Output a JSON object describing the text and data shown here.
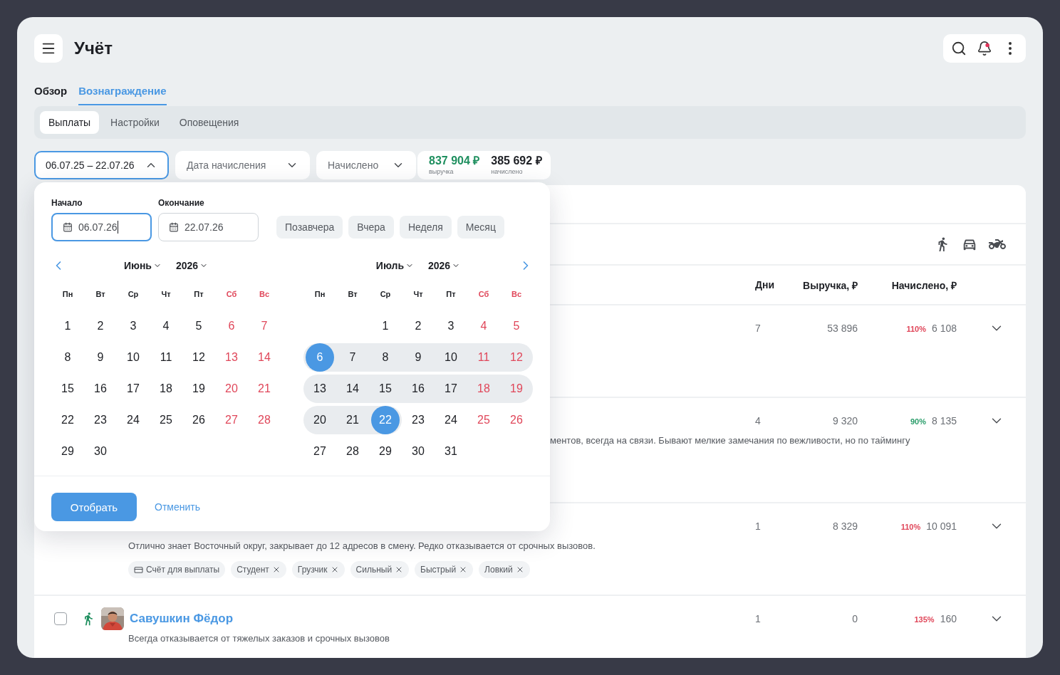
{
  "app": {
    "title": "Учёт"
  },
  "tabs": [
    {
      "label": "Обзор",
      "selected": false
    },
    {
      "label": "Вознаграждение",
      "selected": true
    }
  ],
  "subtabs": [
    {
      "label": "Выплаты",
      "selected": true
    },
    {
      "label": "Настройки",
      "selected": false
    },
    {
      "label": "Оповещения",
      "selected": false
    }
  ],
  "filters": [
    {
      "kind": "range",
      "value": "06.07.25 – 22.07.26",
      "expanded": true
    },
    {
      "kind": "select",
      "value": "Дата начисления",
      "expanded": false
    },
    {
      "kind": "select",
      "value": "Начислено",
      "expanded": false
    }
  ],
  "totals": [
    {
      "value": "837 904 ₽",
      "caption": "выручка",
      "color": "#1f8f5f"
    },
    {
      "value": "385 692 ₽",
      "caption": "начислено",
      "color": "#1d1f24"
    }
  ],
  "date_picker": {
    "fields": [
      {
        "label": "Начало",
        "value": "06.07.26",
        "focused": true
      },
      {
        "label": "Окончание",
        "value": "22.07.26",
        "focused": false
      }
    ],
    "presets": [
      "Позавчера",
      "Вчера",
      "Неделя",
      "Месяц"
    ],
    "months": [
      {
        "month": "Июнь",
        "year": "2026",
        "weekdays": [
          {
            "label": "Пн",
            "weekend": false
          },
          {
            "label": "Вт",
            "weekend": false
          },
          {
            "label": "Ср",
            "weekend": false
          },
          {
            "label": "Чт",
            "weekend": false
          },
          {
            "label": "Пт",
            "weekend": false
          },
          {
            "label": "Сб",
            "weekend": true
          },
          {
            "label": "Вс",
            "weekend": true
          }
        ],
        "weeks": [
          {
            "kind": "leading",
            "days": [
              {
                "label": "1",
                "selected": false,
                "in_range": false
              },
              {
                "label": "2",
                "selected": false,
                "in_range": false
              },
              {
                "label": "3",
                "selected": false,
                "in_range": false
              },
              {
                "label": "4",
                "selected": false,
                "in_range": false
              },
              {
                "label": "5",
                "selected": false,
                "in_range": false
              },
              {
                "label": "6",
                "selected": false,
                "in_range": false
              },
              {
                "label": "7",
                "selected": false,
                "in_range": false
              }
            ]
          },
          {
            "kind": "leading",
            "days": [
              {
                "label": "8",
                "selected": false,
                "in_range": false
              },
              {
                "label": "9",
                "selected": false,
                "in_range": false
              },
              {
                "label": "10",
                "selected": false,
                "in_range": false
              },
              {
                "label": "11",
                "selected": false,
                "in_range": false
              },
              {
                "label": "12",
                "selected": false,
                "in_range": false
              },
              {
                "label": "13",
                "selected": false,
                "in_range": false
              },
              {
                "label": "14",
                "selected": false,
                "in_range": false
              }
            ]
          },
          {
            "kind": "leading",
            "days": [
              {
                "label": "15",
                "selected": false,
                "in_range": false
              },
              {
                "label": "16",
                "selected": false,
                "in_range": false
              },
              {
                "label": "17",
                "selected": false,
                "in_range": false
              },
              {
                "label": "18",
                "selected": false,
                "in_range": false
              },
              {
                "label": "19",
                "selected": false,
                "in_range": false
              },
              {
                "label": "20",
                "selected": false,
                "in_range": false
              },
              {
                "label": "21",
                "selected": false,
                "in_range": false
              }
            ]
          },
          {
            "kind": "leading",
            "days": [
              {
                "label": "22",
                "selected": false,
                "in_range": false
              },
              {
                "label": "23",
                "selected": false,
                "in_range": false
              },
              {
                "label": "24",
                "selected": false,
                "in_range": false
              },
              {
                "label": "25",
                "selected": false,
                "in_range": false
              },
              {
                "label": "26",
                "selected": false,
                "in_range": false
              },
              {
                "label": "27",
                "selected": false,
                "in_range": false
              },
              {
                "label": "28",
                "selected": false,
                "in_range": false
              }
            ]
          },
          {
            "kind": "leading",
            "days": [
              {
                "label": "29",
                "selected": false,
                "in_range": false
              },
              {
                "label": "30",
                "selected": false,
                "in_range": false
              }
            ]
          }
        ]
      },
      {
        "month": "Июль",
        "year": "2026",
        "weekdays": [
          {
            "label": "Пн",
            "weekend": false
          },
          {
            "label": "Вт",
            "weekend": false
          },
          {
            "label": "Ср",
            "weekend": false
          },
          {
            "label": "Чт",
            "weekend": false
          },
          {
            "label": "Пт",
            "weekend": false
          },
          {
            "label": "Сб",
            "weekend": true
          },
          {
            "label": "Вс",
            "weekend": true
          }
        ],
        "weeks": [
          {
            "kind": "trailing",
            "days": [
              {
                "label": "1",
                "selected": false,
                "in_range": false
              },
              {
                "label": "2",
                "selected": false,
                "in_range": false
              },
              {
                "label": "3",
                "selected": false,
                "in_range": false
              },
              {
                "label": "4",
                "selected": false,
                "in_range": false
              },
              {
                "label": "5",
                "selected": false,
                "in_range": false
              }
            ]
          },
          {
            "kind": "leading",
            "days": [
              {
                "label": "6",
                "selected": true,
                "in_range": true
              },
              {
                "label": "7",
                "selected": false,
                "in_range": true
              },
              {
                "label": "8",
                "selected": false,
                "in_range": true
              },
              {
                "label": "9",
                "selected": false,
                "in_range": true
              },
              {
                "label": "10",
                "selected": false,
                "in_range": true
              },
              {
                "label": "11",
                "selected": false,
                "in_range": true
              },
              {
                "label": "12",
                "selected": false,
                "in_range": true
              }
            ]
          },
          {
            "kind": "leading",
            "days": [
              {
                "label": "13",
                "selected": false,
                "in_range": true
              },
              {
                "label": "14",
                "selected": false,
                "in_range": true
              },
              {
                "label": "15",
                "selected": false,
                "in_range": true
              },
              {
                "label": "16",
                "selected": false,
                "in_range": true
              },
              {
                "label": "17",
                "selected": false,
                "in_range": true
              },
              {
                "label": "18",
                "selected": false,
                "in_range": true
              },
              {
                "label": "19",
                "selected": false,
                "in_range": true
              }
            ]
          },
          {
            "kind": "leading",
            "days": [
              {
                "label": "20",
                "selected": false,
                "in_range": true
              },
              {
                "label": "21",
                "selected": false,
                "in_range": true
              },
              {
                "label": "22",
                "selected": true,
                "in_range": true
              },
              {
                "label": "23",
                "selected": false,
                "in_range": false
              },
              {
                "label": "24",
                "selected": false,
                "in_range": false
              },
              {
                "label": "25",
                "selected": false,
                "in_range": false
              },
              {
                "label": "26",
                "selected": false,
                "in_range": false
              }
            ]
          },
          {
            "kind": "leading",
            "days": [
              {
                "label": "27",
                "selected": false,
                "in_range": false
              },
              {
                "label": "28",
                "selected": false,
                "in_range": false
              },
              {
                "label": "29",
                "selected": false,
                "in_range": false
              },
              {
                "label": "30",
                "selected": false,
                "in_range": false
              },
              {
                "label": "31",
                "selected": false,
                "in_range": false
              }
            ]
          }
        ]
      }
    ],
    "apply": "Отобрать",
    "cancel": "Отменить"
  },
  "table": {
    "columns": [
      "Дни",
      "Выручка, ₽",
      "Начислено, ₽"
    ],
    "rows": [
      {
        "days": "7",
        "revenue": "53 896",
        "percent": {
          "text": "110%",
          "color": "#e0475a"
        },
        "accrued": "6 108"
      },
      {
        "kind": "covered",
        "days": "4",
        "revenue": "9 320",
        "percent": {
          "text": "90%",
          "color": "#2a9d6a"
        },
        "accrued": "8 135",
        "description": "ментов, всегда на связи. Бывают мелкие замечания по вежливости, но по таймингу"
      },
      {
        "kind": "open",
        "days": "1",
        "revenue": "8 329",
        "percent": {
          "text": "110%",
          "color": "#e0475a"
        },
        "accrued": "10 091",
        "description": "Отлично знает Восточный округ, закрывает до 12 адресов в смену. Редко отказывается от срочных вызовов.",
        "tags": [
          {
            "kind": "account",
            "label": "Счёт для выплаты"
          },
          {
            "kind": "removable",
            "label": "Студент"
          },
          {
            "kind": "removable",
            "label": "Грузчик"
          },
          {
            "kind": "removable",
            "label": "Сильный"
          },
          {
            "kind": "removable",
            "label": "Быстрый"
          },
          {
            "kind": "removable",
            "label": "Ловкий"
          }
        ]
      },
      {
        "kind": "open",
        "checked": false,
        "name": "Савушкин Фёдор",
        "days": "1",
        "revenue": "0",
        "percent": {
          "text": "135%",
          "color": "#e0475a"
        },
        "accrued": "160",
        "description": "Всегда отказывается от тяжелых заказов и срочных вызовов"
      }
    ]
  }
}
